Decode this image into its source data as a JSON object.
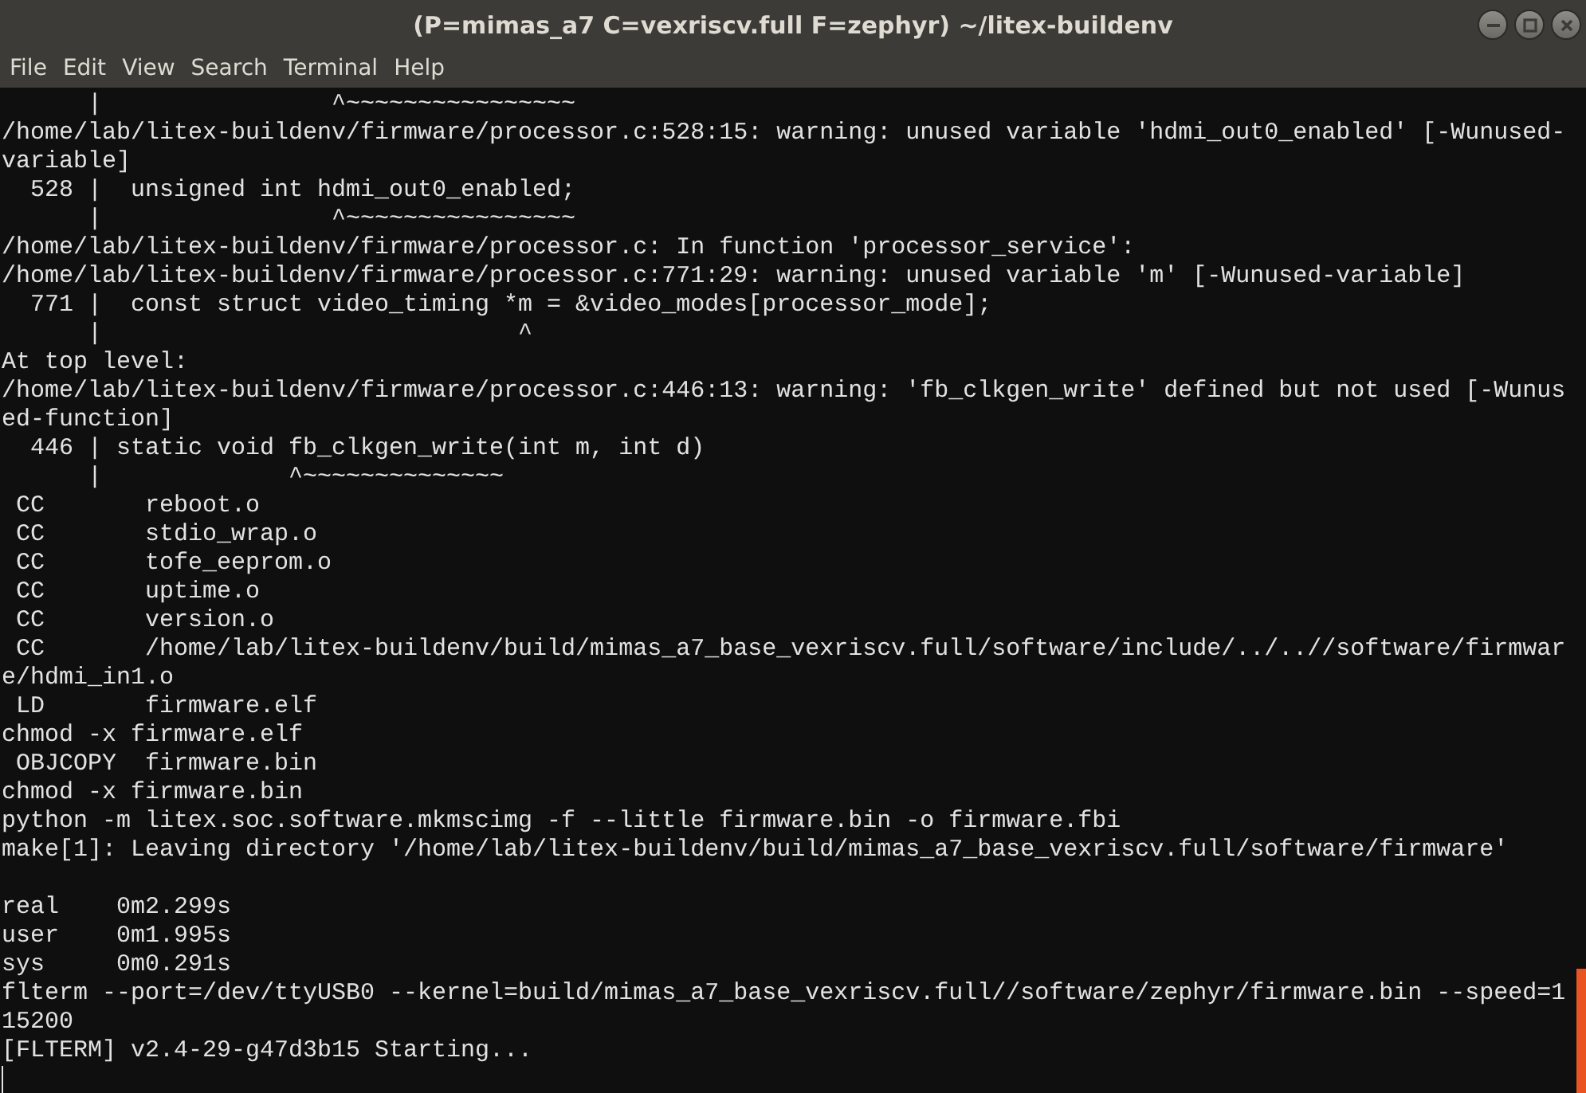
{
  "window": {
    "title": "(P=mimas_a7 C=vexriscv.full F=zephyr) ~/litex-buildenv"
  },
  "menu": [
    "File",
    "Edit",
    "View",
    "Search",
    "Terminal",
    "Help"
  ],
  "terminal": {
    "blocks": [
      [
        "      |                ^~~~~~~~~~~~~~~~~",
        "/home/lab/litex-buildenv/firmware/processor.c:528:15: warning: unused variable 'hdmi_out0_enabled' [-Wunused-",
        "variable]",
        "  528 |  unsigned int hdmi_out0_enabled;",
        "      |                ^~~~~~~~~~~~~~~~~",
        "/home/lab/litex-buildenv/firmware/processor.c: In function 'processor_service':",
        "/home/lab/litex-buildenv/firmware/processor.c:771:29: warning: unused variable 'm' [-Wunused-variable]",
        "  771 |  const struct video_timing *m = &video_modes[processor_mode];",
        "      |                             ^",
        "At top level:",
        "/home/lab/litex-buildenv/firmware/processor.c:446:13: warning: 'fb_clkgen_write' defined but not used [-Wunus",
        "ed-function]",
        "  446 | static void fb_clkgen_write(int m, int d)",
        "      |             ^~~~~~~~~~~~~~~",
        " CC       reboot.o",
        " CC       stdio_wrap.o",
        " CC       tofe_eeprom.o",
        " CC       uptime.o",
        " CC       version.o",
        " CC       /home/lab/litex-buildenv/build/mimas_a7_base_vexriscv.full/software/include/../..//software/firmwar",
        "e/hdmi_in1.o",
        " LD       firmware.elf",
        "chmod -x firmware.elf",
        " OBJCOPY  firmware.bin",
        "chmod -x firmware.bin",
        "python -m litex.soc.software.mkmscimg -f --little firmware.bin -o firmware.fbi",
        "make[1]: Leaving directory '/home/lab/litex-buildenv/build/mimas_a7_base_vexriscv.full/software/firmware'"
      ],
      [
        "real    0m2.299s",
        "user    0m1.995s",
        "sys     0m0.291s",
        "flterm --port=/dev/ttyUSB0 --kernel=build/mimas_a7_base_vexriscv.full//software/zephyr/firmware.bin --speed=1",
        "15200",
        "[FLTERM] v2.4-29-g47d3b15 Starting..."
      ]
    ]
  }
}
